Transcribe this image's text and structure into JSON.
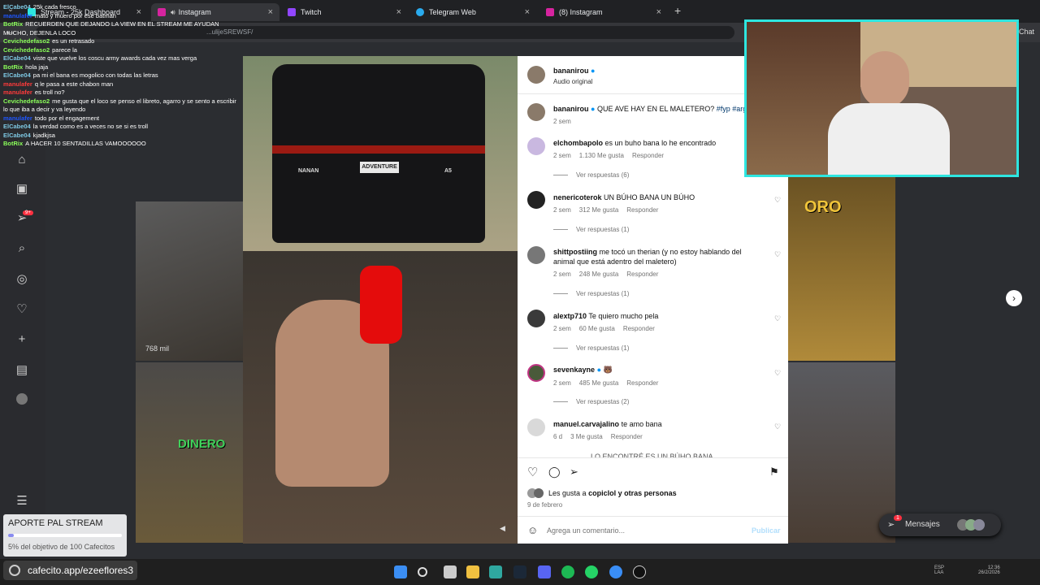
{
  "browser": {
    "tabs": [
      {
        "label": "Stream - 25k Dashboard",
        "sub": "25k cada fresco"
      },
      {
        "label": "Instagram"
      },
      {
        "label": "Twitch"
      },
      {
        "label": "Telegram Web"
      },
      {
        "label": "(8) Instagram"
      }
    ],
    "url": "...ulijeSREWSF/",
    "right_label": "Chat"
  },
  "chat": [
    {
      "user": "ElCabe04",
      "text": "25k cada fresco",
      "color": "#7ec8e3"
    },
    {
      "user": "manulafer",
      "text": "mato y muero por ese batman",
      "color": "#1e56ff"
    },
    {
      "user": "BotRix",
      "text": "RECUERDEN QUE DEJANDO LA VIEW EN EL STREAM ME AYUDAN MUCHO, DEJENLA LOCO",
      "color": "#8bff5a"
    },
    {
      "user": "Cevichedefaso2",
      "text": "es un retrasado",
      "color": "#8bff5a"
    },
    {
      "user": "Cevichedefaso2",
      "text": "parece la",
      "color": "#8bff5a"
    },
    {
      "user": "ElCabe04",
      "text": "viste que vuelve los coscu army awards cada vez mas verga",
      "color": "#7ec8e3"
    },
    {
      "user": "BotRix",
      "text": "hola jaja",
      "color": "#8bff5a"
    },
    {
      "user": "ElCabe04",
      "text": "pa mi el bana es mogolico con todas las letras",
      "color": "#7ec8e3"
    },
    {
      "user": "manulafer",
      "text": "q le pasa a este chabon man",
      "color": "#ff3b3b"
    },
    {
      "user": "manulafer",
      "text": "es troll no?",
      "color": "#ff3b3b"
    },
    {
      "user": "Cevichedefaso2",
      "text": "me gusta que el loco se penso el libreto, agarro y se sento a escribir lo que iba a decir y va leyendo",
      "color": "#8bff5a"
    },
    {
      "user": "manulafer",
      "text": "todo por el engagement",
      "color": "#1e56ff"
    },
    {
      "user": "ElCabe04",
      "text": "la verdad como es a veces no se si es troll",
      "color": "#7ec8e3"
    },
    {
      "user": "ElCabe04",
      "text": "kjadkjsa",
      "color": "#7ec8e3"
    },
    {
      "user": "BotRix",
      "text": "A HACER 10 SENTADILLAS VAMOOOOOO",
      "color": "#8bff5a"
    }
  ],
  "grid": {
    "views": "768 mil",
    "tile_dinero": "DINERO",
    "tile_oro": "ORO"
  },
  "video": {
    "plate": "ADVENTURE",
    "brand": "NANAN",
    "model": "A5"
  },
  "post": {
    "author": "bananirou",
    "audio": "Audio original",
    "caption": "QUE AVE HAY EN EL MALETERO?",
    "caption_tags": "#fyp #arg",
    "caption_age": "2 sem",
    "comments": [
      {
        "user": "elchombapolo",
        "text": "es un buho bana lo he encontrado",
        "age": "2 sem",
        "likes": "1.130 Me gusta",
        "reply": "Responder",
        "replies": "Ver respuestas (6)"
      },
      {
        "user": "nenericoterok",
        "text": "UN BÚHO BANA UN BÚHO",
        "age": "2 sem",
        "likes": "312 Me gusta",
        "reply": "Responder",
        "replies": "Ver respuestas (1)"
      },
      {
        "user": "shittpostiing",
        "text": "me tocó un therian (y no estoy hablando del",
        "text2": "animal que está adentro del maletero)",
        "age": "2 sem",
        "likes": "248 Me gusta",
        "reply": "Responder",
        "replies": "Ver respuestas (1)"
      },
      {
        "user": "alextp710",
        "text": "Te quiero mucho pela",
        "age": "2 sem",
        "likes": "60 Me gusta",
        "reply": "Responder",
        "replies": "Ver respuestas (1)"
      },
      {
        "user": "sevenkayne",
        "text": "🐻",
        "age": "2 sem",
        "likes": "485 Me gusta",
        "reply": "Responder",
        "replies": "Ver respuestas (2)"
      },
      {
        "user": "manuel.carvajalino",
        "text": "te amo bana",
        "age": "6 d",
        "likes": "3 Me gusta",
        "reply": "Responder",
        "replies": ""
      }
    ],
    "partial_comment": "LO ENCONTRÉ ES UN BÚHO BANA",
    "likes_text": "Les gusta a",
    "likes_user": "copiclol",
    "likes_others": "y otras personas",
    "date": "9 de febrero",
    "comment_placeholder": "Agrega un comentario...",
    "publish": "Publicar"
  },
  "messages": {
    "label": "Mensajes",
    "badge": "1"
  },
  "donation": {
    "title": "APORTE PAL STREAM",
    "progress_text": "5% del objetivo de 100 Cafecitos",
    "progress": 0.05
  },
  "cafecito": "cafecito.app/ezeeflores3",
  "notif_badge": "9+",
  "taskbar": {
    "lang": "ESP",
    "lang2": "LAA",
    "time": "12:36",
    "date": "26/2/2026"
  },
  "colors": {
    "accent": "#2ee6e0",
    "ig_blue": "#0095f6",
    "progress": "#8a8cf0"
  }
}
